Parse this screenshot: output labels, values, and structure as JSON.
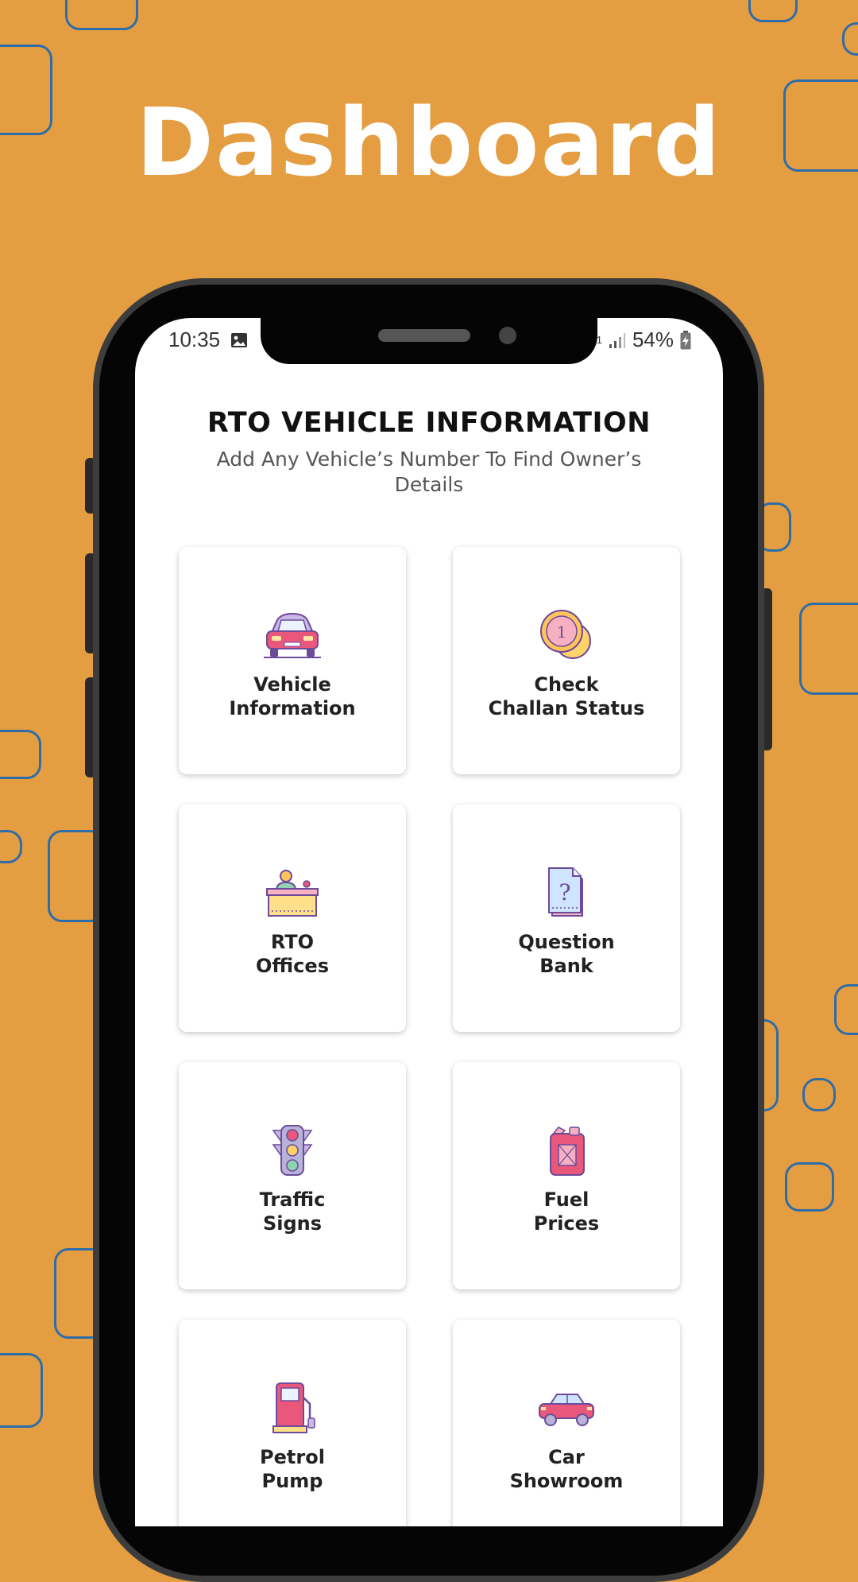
{
  "promo": {
    "headline": "Dashboard"
  },
  "status_bar": {
    "time": "10:35",
    "battery": "54%",
    "signal": "E1"
  },
  "app": {
    "title": "RTO VEHICLE INFORMATION",
    "subtitle": "Add Any Vehicle’s Number To Find Owner’s Details"
  },
  "menu": [
    {
      "label": "Vehicle\nInformation",
      "icon": "car-icon"
    },
    {
      "label": "Check\nChallan Status",
      "icon": "coin-icon"
    },
    {
      "label": "RTO\nOffices",
      "icon": "office-desk-icon"
    },
    {
      "label": "Question\nBank",
      "icon": "question-document-icon"
    },
    {
      "label": "Traffic\nSigns",
      "icon": "traffic-light-icon"
    },
    {
      "label": "Fuel\nPrices",
      "icon": "fuel-can-icon"
    },
    {
      "label": "Petrol\nPump",
      "icon": "petrol-pump-icon"
    },
    {
      "label": "Car\nShowroom",
      "icon": "showroom-car-icon"
    }
  ],
  "colors": {
    "background": "#E59D42",
    "decor_outline": "#2F6DA8",
    "accent_pink": "#E9577A"
  }
}
